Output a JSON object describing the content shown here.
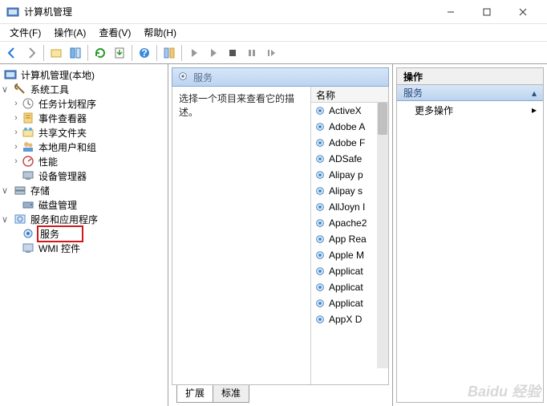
{
  "window": {
    "title": "计算机管理"
  },
  "menu": {
    "file": "文件(F)",
    "action": "操作(A)",
    "view": "查看(V)",
    "help": "帮助(H)"
  },
  "tree": {
    "root": "计算机管理(本地)",
    "system_tools": "系统工具",
    "task_scheduler": "任务计划程序",
    "event_viewer": "事件查看器",
    "shared_folders": "共享文件夹",
    "local_users": "本地用户和组",
    "performance": "性能",
    "device_manager": "设备管理器",
    "storage": "存储",
    "disk_mgmt": "磁盘管理",
    "services_apps": "服务和应用程序",
    "services": "服务",
    "wmi": "WMI 控件"
  },
  "middle": {
    "header": "服务",
    "description": "选择一个项目来查看它的描述。",
    "col_name": "名称",
    "services": [
      "ActiveX",
      "Adobe A",
      "Adobe F",
      "ADSafe",
      "Alipay p",
      "Alipay s",
      "AllJoyn I",
      "Apache2",
      "App Rea",
      "Apple M",
      "Applicat",
      "Applicat",
      "Applicat",
      "AppX D"
    ],
    "tab_ext": "扩展",
    "tab_std": "标准"
  },
  "actions": {
    "head": "操作",
    "section": "服务",
    "more": "更多操作"
  },
  "watermark": "Baidu 经验"
}
